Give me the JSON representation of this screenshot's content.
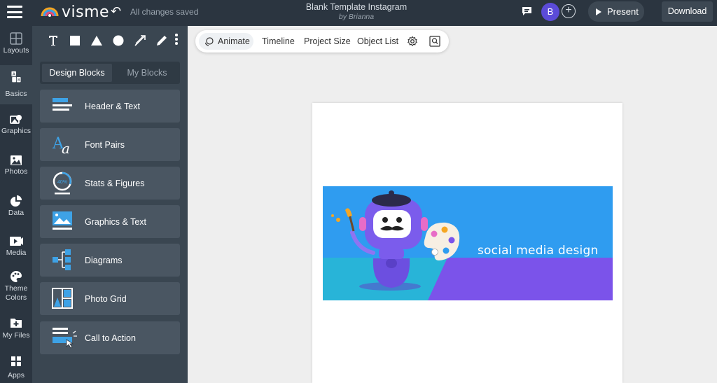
{
  "topbar": {
    "app_name": "visme",
    "save_status": "All changes saved",
    "document_title": "Blank Template Instagram",
    "document_author": "by Brianna",
    "avatar_initial": "B",
    "add_collaborator": "+",
    "present_label": "Present",
    "download_label": "Download"
  },
  "rail": {
    "items": [
      {
        "label": "Layouts",
        "icon": "layouts-icon"
      },
      {
        "label": "Basics",
        "icon": "basics-icon"
      },
      {
        "label": "Graphics",
        "icon": "graphics-icon"
      },
      {
        "label": "Photos",
        "icon": "photos-icon"
      },
      {
        "label": "Data",
        "icon": "data-icon"
      },
      {
        "label": "Media",
        "icon": "media-icon"
      },
      {
        "label": "Theme Colors",
        "icon": "palette-icon"
      },
      {
        "label": "My Files",
        "icon": "my-files-icon"
      },
      {
        "label": "Apps",
        "icon": "apps-icon"
      }
    ],
    "active": "Basics"
  },
  "panel": {
    "tools": [
      "text-tool",
      "rectangle-tool",
      "triangle-tool",
      "circle-tool",
      "arrow-tool",
      "pencil-tool"
    ],
    "tabs": {
      "design_blocks": "Design Blocks",
      "my_blocks": "My Blocks"
    },
    "blocks": [
      {
        "label": "Header & Text"
      },
      {
        "label": "Font Pairs"
      },
      {
        "label": "Stats & Figures",
        "icon_text": "40%"
      },
      {
        "label": "Graphics & Text"
      },
      {
        "label": "Diagrams"
      },
      {
        "label": "Photo Grid"
      },
      {
        "label": "Call to Action"
      }
    ]
  },
  "canvas_toolbar": {
    "animate": "Animate",
    "timeline": "Timeline",
    "project_size": "Project Size",
    "object_list": "Object List"
  },
  "canvas": {
    "banner_text": "social media design"
  },
  "colors": {
    "chrome_dark": "#2b3540",
    "panel": "#3a4651",
    "block": "#4a5662",
    "accent_blue": "#3ea2e6",
    "banner_blue": "#2f9cf0",
    "banner_purple": "#7b53ea",
    "avatar": "#5b4bd8"
  }
}
